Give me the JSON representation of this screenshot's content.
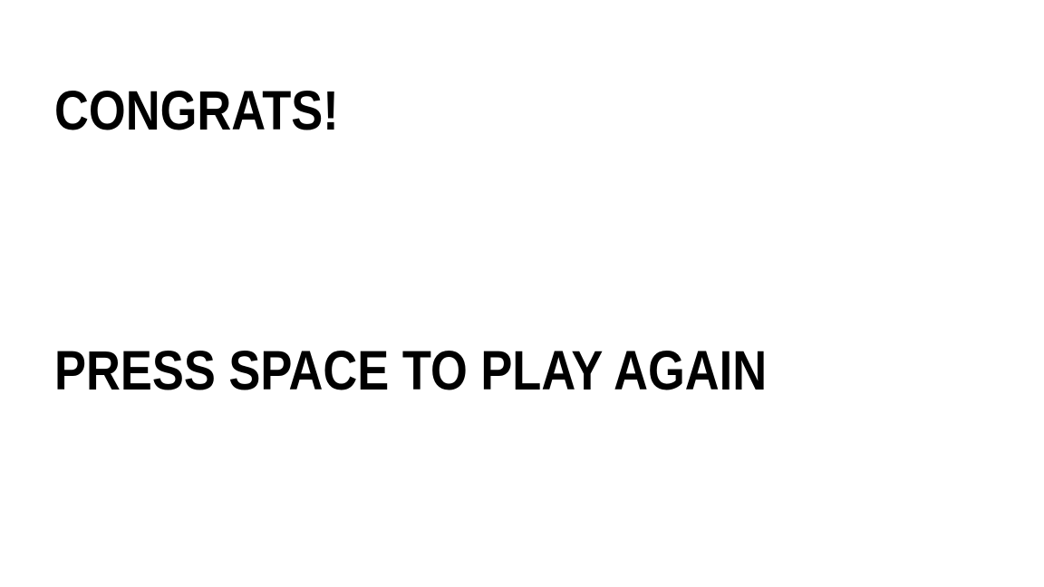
{
  "screen": {
    "title": "CONGRATS!",
    "prompt": "PRESS SPACE TO PLAY AGAIN",
    "background_color": "#ffffff",
    "text_color": "#000000"
  }
}
